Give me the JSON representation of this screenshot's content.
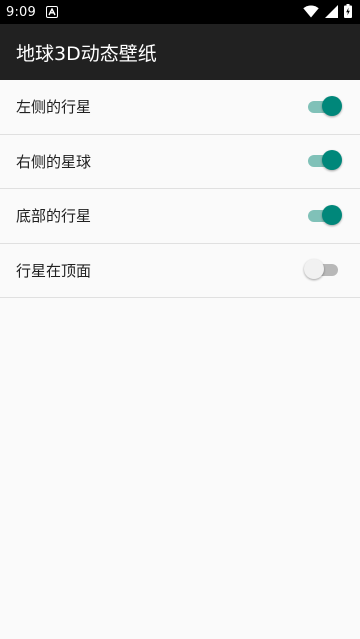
{
  "status_bar": {
    "time": "9:09",
    "notification_icon": "a-icon",
    "wifi_icon": "wifi-icon",
    "signal_icon": "signal-icon",
    "battery_icon": "battery-charging-icon"
  },
  "app_bar": {
    "title": "地球3D动态壁纸"
  },
  "settings": [
    {
      "label": "左侧的行星",
      "enabled": true
    },
    {
      "label": "右侧的星球",
      "enabled": true
    },
    {
      "label": "底部的行星",
      "enabled": true
    },
    {
      "label": "行星在顶面",
      "enabled": false
    }
  ],
  "colors": {
    "accent": "#00877a",
    "accent_track": "#80c1b8",
    "app_bar": "#212121",
    "status_bar": "#000000",
    "background": "#fafafa"
  }
}
